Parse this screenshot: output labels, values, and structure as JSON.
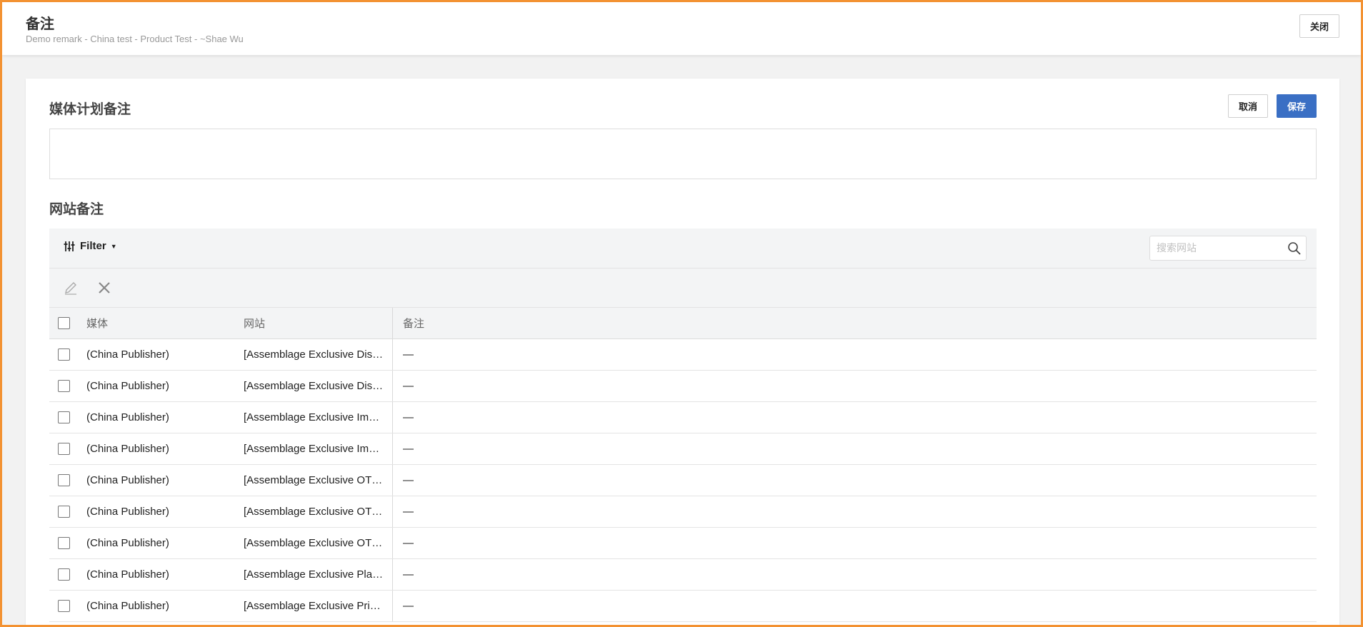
{
  "header": {
    "title": "备注",
    "subtitle": "Demo remark - China test - Product Test - ~Shae Wu",
    "close_label": "关闭"
  },
  "plan_notes": {
    "title": "媒体计划备注",
    "cancel_label": "取消",
    "save_label": "保存",
    "value": ""
  },
  "site_notes": {
    "title": "网站备注",
    "filter_label": "Filter",
    "search_placeholder": "搜索网站",
    "columns": {
      "media": "媒体",
      "site": "网站",
      "note": "备注"
    },
    "rows": [
      {
        "media": "(China Publisher)",
        "site": "[Assemblage Exclusive Dis…",
        "note": "—"
      },
      {
        "media": "(China Publisher)",
        "site": "[Assemblage Exclusive Dis…",
        "note": "—"
      },
      {
        "media": "(China Publisher)",
        "site": "[Assemblage Exclusive Im…",
        "note": "—"
      },
      {
        "media": "(China Publisher)",
        "site": "[Assemblage Exclusive Im…",
        "note": "—"
      },
      {
        "media": "(China Publisher)",
        "site": "[Assemblage Exclusive OT…",
        "note": "—"
      },
      {
        "media": "(China Publisher)",
        "site": "[Assemblage Exclusive OT…",
        "note": "—"
      },
      {
        "media": "(China Publisher)",
        "site": "[Assemblage Exclusive OT…",
        "note": "—"
      },
      {
        "media": "(China Publisher)",
        "site": "[Assemblage Exclusive Pla…",
        "note": "—"
      },
      {
        "media": "(China Publisher)",
        "site": "[Assemblage Exclusive Pri…",
        "note": "—"
      }
    ]
  },
  "colors": {
    "frame": "#f39232",
    "primary": "#3a6fc4",
    "toolbar_bg": "#f3f4f5"
  },
  "icons": {
    "filter": "sliders-icon",
    "search": "search-icon",
    "edit": "pencil-icon",
    "delete": "close-icon",
    "filter_caret": "caret-down-icon"
  }
}
